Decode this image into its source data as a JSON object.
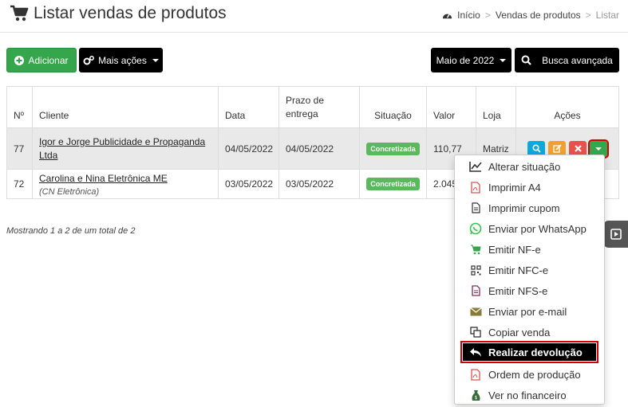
{
  "header": {
    "title": "Listar vendas de produtos",
    "breadcrumb": [
      "Início",
      "Vendas de produtos",
      "Listar"
    ]
  },
  "toolbar": {
    "add_label": "Adicionar",
    "more_label": "Mais ações",
    "month_label": "Maio de 2022",
    "search_label": "Busca avançada"
  },
  "table": {
    "columns": [
      "Nº",
      "Cliente",
      "Data",
      "Prazo de entrega",
      "Situação",
      "Valor",
      "Loja",
      "Ações"
    ],
    "rows": [
      {
        "num": "77",
        "cliente": "Igor e Jorge Publicidade e Propaganda Ltda",
        "sub": "",
        "data": "04/05/2022",
        "prazo": "04/05/2022",
        "situacao": "Concretizada",
        "valor": "110,77",
        "loja": "Matriz"
      },
      {
        "num": "72",
        "cliente": "Carolina e Nina Eletrônica ME",
        "sub": "(CN Eletrônica)",
        "data": "03/05/2022",
        "prazo": "03/05/2022",
        "situacao": "Concretizada",
        "valor": "2.045",
        "loja": ""
      }
    ]
  },
  "status_text": "Mostrando 1 a 2 de um total de 2",
  "dropdown": {
    "items": [
      {
        "label": "Alterar situação",
        "icon": "chart-line-icon"
      },
      {
        "label": "Imprimir A4",
        "icon": "pdf-icon"
      },
      {
        "label": "Imprimir cupom",
        "icon": "receipt-icon"
      },
      {
        "label": "Enviar por WhatsApp",
        "icon": "whatsapp-icon"
      },
      {
        "label": "Emitir NF-e",
        "icon": "cart-icon"
      },
      {
        "label": "Emitir NFC-e",
        "icon": "qrcode-icon"
      },
      {
        "label": "Emitir NFS-e",
        "icon": "document-icon"
      },
      {
        "label": "Enviar por e-mail",
        "icon": "envelope-icon"
      },
      {
        "label": "Copiar venda",
        "icon": "copy-icon"
      },
      {
        "label": "Realizar devolução",
        "icon": "reply-icon"
      },
      {
        "label": "Ordem de produção",
        "icon": "pdf-icon"
      },
      {
        "label": "Ver no financeiro",
        "icon": "money-bag-icon"
      }
    ]
  },
  "colors": {
    "green": "#36a64d",
    "blue": "#0aa8df",
    "orange": "#f0a030",
    "red": "#e8524c",
    "highlight_border": "#d40000"
  }
}
